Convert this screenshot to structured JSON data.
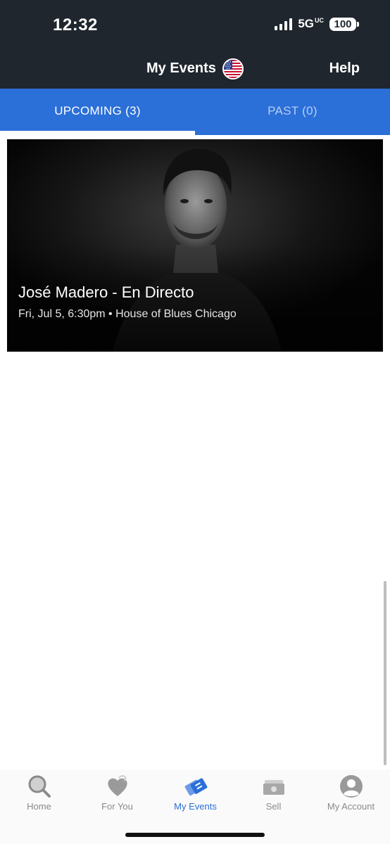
{
  "status_bar": {
    "time": "12:32",
    "network": "5G",
    "network_suffix": "UC",
    "battery": "100"
  },
  "header": {
    "title": "My Events",
    "flag_icon": "us-flag-icon",
    "help_label": "Help"
  },
  "tabs": {
    "upcoming_label": "UPCOMING (3)",
    "past_label": "PAST (0)",
    "active": "upcoming"
  },
  "events": [
    {
      "title": "José Madero - En Directo",
      "details": "Fri, Jul 5, 6:30pm • House of Blues Chicago"
    }
  ],
  "bottom_nav": {
    "items": [
      {
        "label": "Home",
        "icon": "search-icon",
        "active": false
      },
      {
        "label": "For You",
        "icon": "heart-icon",
        "active": false
      },
      {
        "label": "My Events",
        "icon": "tickets-icon",
        "active": true
      },
      {
        "label": "Sell",
        "icon": "money-icon",
        "active": false
      },
      {
        "label": "My Account",
        "icon": "account-icon",
        "active": false
      }
    ]
  },
  "colors": {
    "header_bg": "#1f262d",
    "tab_bg": "#2b6fd8",
    "accent": "#2b6fd8",
    "inactive_nav": "#8a8a8a"
  }
}
